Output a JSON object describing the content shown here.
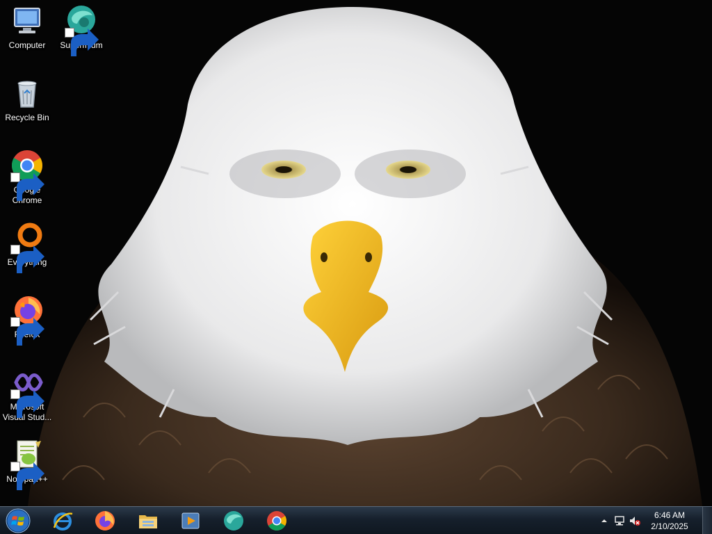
{
  "desktop": {
    "icons": [
      {
        "label": "Computer",
        "icon": "computer-icon",
        "shortcut": false
      },
      {
        "label": "Supermium",
        "icon": "supermium-icon",
        "shortcut": true
      },
      {
        "label": "Recycle Bin",
        "icon": "recycle-bin-icon",
        "shortcut": false
      },
      {
        "label": "Google Chrome",
        "icon": "chrome-icon",
        "shortcut": true
      },
      {
        "label": "Everything",
        "icon": "everything-icon",
        "shortcut": true
      },
      {
        "label": "Firefox",
        "icon": "firefox-icon",
        "shortcut": true
      },
      {
        "label": "Microsoft Visual Stud...",
        "icon": "visual-studio-icon",
        "shortcut": true
      },
      {
        "label": "Notepad++",
        "icon": "notepadpp-icon",
        "shortcut": true
      }
    ],
    "wallpaper": "bald-eagle"
  },
  "taskbar": {
    "start": {
      "icon": "windows-start-icon"
    },
    "pinned": [
      {
        "icon": "internet-explorer-icon"
      },
      {
        "icon": "firefox-icon"
      },
      {
        "icon": "file-explorer-icon"
      },
      {
        "icon": "media-player-icon"
      },
      {
        "icon": "supermium-icon"
      },
      {
        "icon": "chrome-icon"
      }
    ],
    "tray": {
      "icons": [
        "show-hidden-icons-chevron",
        "network-icon",
        "volume-muted-icon"
      ],
      "time": "6:46 AM",
      "date": "2/10/2025"
    }
  },
  "colors": {
    "taskbar": "#16202c",
    "eagle_beak": "#f0b81c",
    "eagle_head": "#f2f2f2",
    "eagle_body": "#4a3524"
  }
}
